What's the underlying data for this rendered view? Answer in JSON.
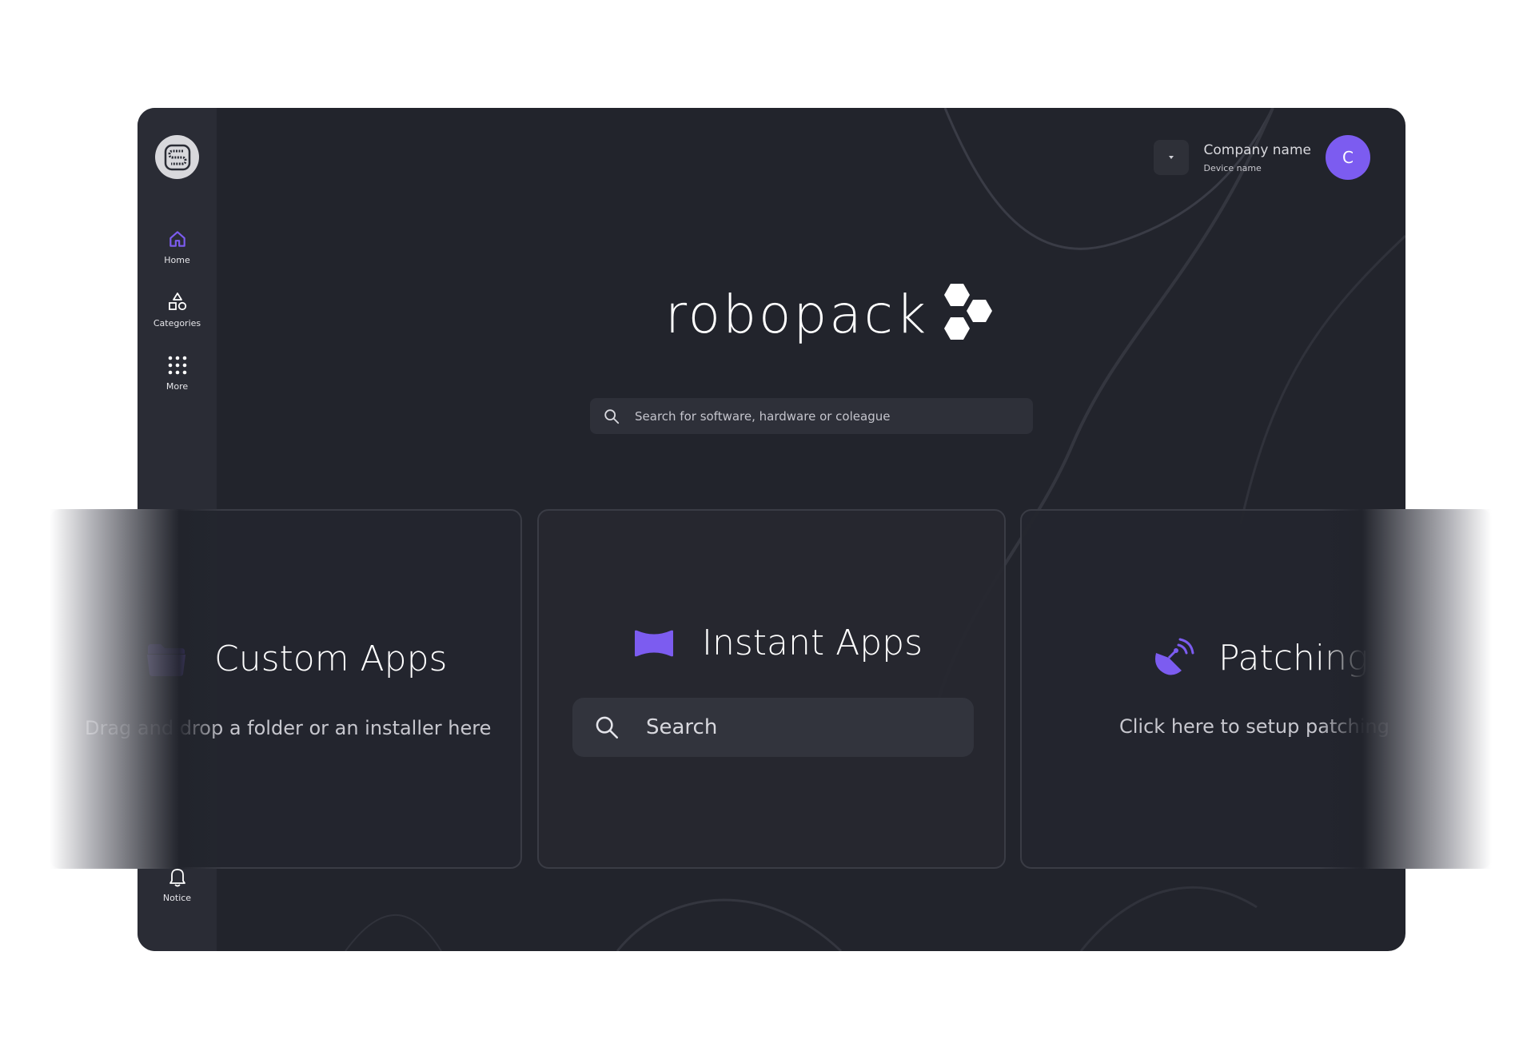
{
  "sidebar": {
    "items": [
      {
        "key": "home",
        "label": "Home",
        "icon": "home-icon",
        "active": true
      },
      {
        "key": "categories",
        "label": "Categories",
        "icon": "shapes-icon"
      },
      {
        "key": "more",
        "label": "More",
        "icon": "grid-dots-icon"
      }
    ],
    "notice": {
      "label": "Notice",
      "icon": "bell-icon"
    }
  },
  "account": {
    "company_name": "Company name",
    "device_name": "Device name",
    "avatar_initial": "C"
  },
  "brand": {
    "wordmark": "robopack"
  },
  "search": {
    "placeholder": "Search for software, hardware or coleague"
  },
  "cards": {
    "custom_apps": {
      "title": "Custom Apps",
      "subtitle": "Drag and drop a folder or an installer here",
      "icon": "folder-icon"
    },
    "instant_apps": {
      "title": "Instant Apps",
      "icon": "bowtie-icon",
      "search_placeholder": "Search"
    },
    "patching": {
      "title": "Patching",
      "subtitle": "Click here to setup patching",
      "icon": "satellite-dish-icon"
    }
  },
  "colors": {
    "accent": "#7c5cf0",
    "background": "#22242c",
    "sidebar": "#2a2c35",
    "text": "#ffffff"
  }
}
